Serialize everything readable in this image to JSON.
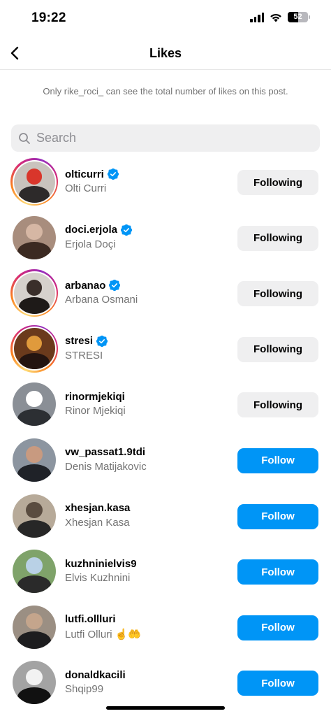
{
  "status_bar": {
    "time": "19:22",
    "battery": "52",
    "icons": [
      "cellular-signal-icon",
      "wifi-icon",
      "battery-icon"
    ]
  },
  "header": {
    "title": "Likes",
    "back_icon": "chevron-left-icon"
  },
  "notice": "Only rike_roci_ can see the total number of likes on this post.",
  "search": {
    "placeholder": "Search",
    "value": ""
  },
  "users": [
    {
      "username": "olticurri",
      "full_name": "Olti Curri",
      "verified": true,
      "story_ring": true,
      "button": "Following",
      "state": "following",
      "avatar_bg": "#c9c3bd",
      "avatar_fg": "#2d2a2a",
      "avatar_accent": "#d9362b"
    },
    {
      "username": "doci.erjola",
      "full_name": "Erjola Doçi",
      "verified": true,
      "story_ring": false,
      "button": "Following",
      "state": "following",
      "avatar_bg": "#a88d7d",
      "avatar_fg": "#3b2a22",
      "avatar_accent": "#d6b7a4"
    },
    {
      "username": "arbanao",
      "full_name": "Arbana Osmani",
      "verified": true,
      "story_ring": true,
      "button": "Following",
      "state": "following",
      "avatar_bg": "#d6d1cc",
      "avatar_fg": "#1e1a18",
      "avatar_accent": "#3a2f2a"
    },
    {
      "username": "stresi",
      "full_name": "STRESI",
      "verified": true,
      "story_ring": true,
      "button": "Following",
      "state": "following",
      "avatar_bg": "#6b3a1c",
      "avatar_fg": "#241410",
      "avatar_accent": "#e09a3c"
    },
    {
      "username": "rinormjekiqi",
      "full_name": "Rinor Mjekiqi",
      "verified": false,
      "story_ring": false,
      "button": "Following",
      "state": "following",
      "avatar_bg": "#8a8f96",
      "avatar_fg": "#2c2f33",
      "avatar_accent": "#ffffff"
    },
    {
      "username": "vw_passat1.9tdi",
      "full_name": "Denis Matijakovic",
      "verified": false,
      "story_ring": false,
      "button": "Follow",
      "state": "follow",
      "avatar_bg": "#8c95a0",
      "avatar_fg": "#1f2228",
      "avatar_accent": "#c89a80"
    },
    {
      "username": "xhesjan.kasa",
      "full_name": "Xhesjan Kasa",
      "verified": false,
      "story_ring": false,
      "button": "Follow",
      "state": "follow",
      "avatar_bg": "#b7aa99",
      "avatar_fg": "#272727",
      "avatar_accent": "#5a4c40"
    },
    {
      "username": "kuzhninielvis9",
      "full_name": "Elvis Kuzhnini",
      "verified": false,
      "story_ring": false,
      "button": "Follow",
      "state": "follow",
      "avatar_bg": "#7fa36a",
      "avatar_fg": "#2a2a2a",
      "avatar_accent": "#b9d1e6"
    },
    {
      "username": "lutfi.ollluri",
      "full_name": "Lutfi Olluri ☝️🤲",
      "verified": false,
      "story_ring": false,
      "button": "Follow",
      "state": "follow",
      "avatar_bg": "#9b8f83",
      "avatar_fg": "#1d1d1f",
      "avatar_accent": "#c4a58c"
    },
    {
      "username": "donaldkacili",
      "full_name": "Shqip99",
      "verified": false,
      "story_ring": false,
      "button": "Follow",
      "state": "follow",
      "avatar_bg": "#a3a3a3",
      "avatar_fg": "#111111",
      "avatar_accent": "#f2f2f2"
    }
  ],
  "colors": {
    "follow_blue": "#0095f6",
    "following_gray": "#efeff0",
    "verified_blue": "#0095f6",
    "secondary_text": "#737373"
  }
}
